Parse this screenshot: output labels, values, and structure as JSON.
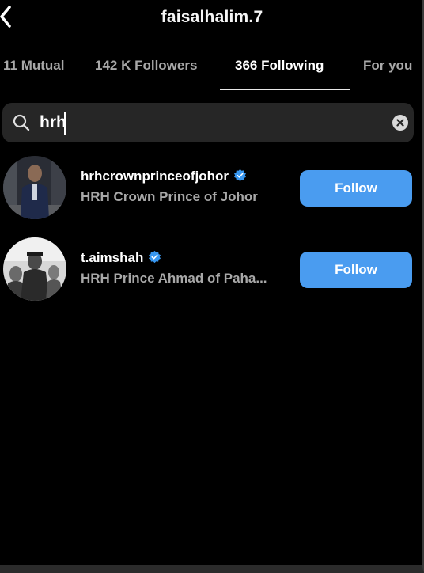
{
  "header": {
    "title": "faisalhalim.7",
    "back_icon": "chevron-left-icon"
  },
  "tabs": [
    {
      "label": "11 Mutual",
      "active": false
    },
    {
      "label": "142 K Followers",
      "active": false
    },
    {
      "label": "366 Following",
      "active": true
    },
    {
      "label": "For you",
      "active": false
    }
  ],
  "search": {
    "value": "hrh",
    "placeholder": "Search",
    "icon": "search-icon",
    "clear_icon": "clear-icon"
  },
  "results": [
    {
      "username": "hrhcrownprinceofjohor",
      "verified": true,
      "name": "HRH Crown Prince of Johor",
      "button": "Follow"
    },
    {
      "username": "t.aimshah",
      "verified": true,
      "name": "HRH Prince Ahmad of Paha...",
      "button": "Follow"
    }
  ],
  "colors": {
    "background": "#000000",
    "accent": "#4a9cf0",
    "secondary_text": "#a8a8a8",
    "verified_badge": "#3897f0"
  }
}
